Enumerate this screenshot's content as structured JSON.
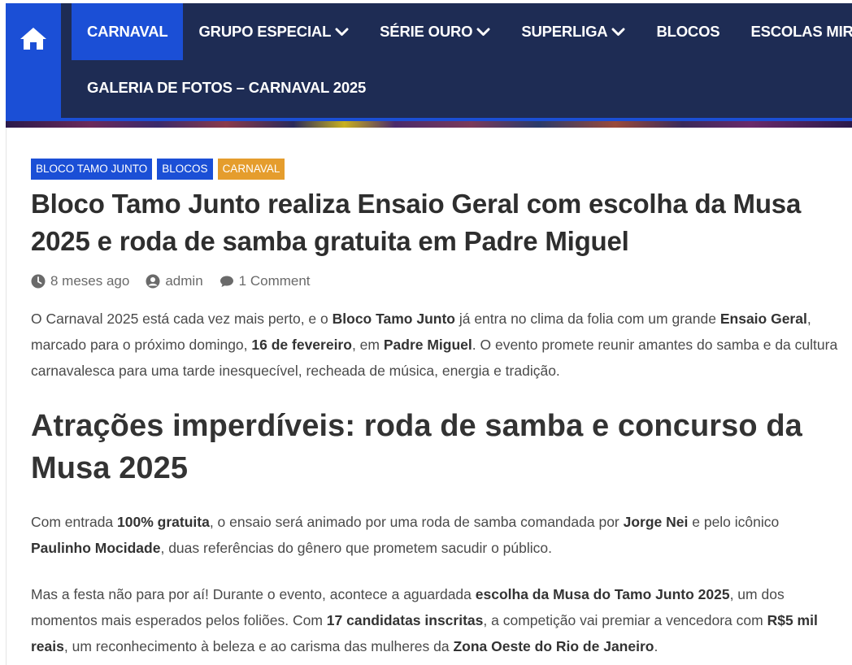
{
  "nav": {
    "home_icon": "home-icon",
    "items": [
      {
        "label": "CARNAVAL",
        "active": true,
        "has_dropdown": false
      },
      {
        "label": "GRUPO ESPECIAL",
        "active": false,
        "has_dropdown": true
      },
      {
        "label": "SÉRIE OURO",
        "active": false,
        "has_dropdown": true
      },
      {
        "label": "SUPERLIGA",
        "active": false,
        "has_dropdown": true
      },
      {
        "label": "BLOCOS",
        "active": false,
        "has_dropdown": false
      },
      {
        "label": "ESCOLAS MIRINS",
        "active": false,
        "has_dropdown": false
      }
    ],
    "row2": [
      {
        "label": "GALERIA DE FOTOS – CARNAVAL 2025"
      }
    ],
    "colors": {
      "bar": "#1e2c54",
      "accent": "#1b4fd6"
    }
  },
  "article": {
    "categories": [
      {
        "label": "BLOCO TAMO JUNTO",
        "color": "#1b4fd6"
      },
      {
        "label": "BLOCOS",
        "color": "#1b4fd6"
      },
      {
        "label": "CARNAVAL",
        "color": "#e59d2d"
      }
    ],
    "title": "Bloco Tamo Junto realiza Ensaio Geral com escolha da Musa 2025 e roda de samba gratuita em Padre Miguel",
    "meta": {
      "date": "8 meses ago",
      "author": "admin",
      "comments": "1 Comment"
    },
    "p1": [
      {
        "t": "O Carnaval 2025 está cada vez mais perto, e o "
      },
      {
        "t": "Bloco Tamo Junto",
        "b": true
      },
      {
        "t": " já entra no clima da folia com um grande "
      },
      {
        "t": "Ensaio Geral",
        "b": true
      },
      {
        "t": ", marcado para o próximo domingo, "
      },
      {
        "t": "16 de fevereiro",
        "b": true
      },
      {
        "t": ", em "
      },
      {
        "t": "Padre Miguel",
        "b": true
      },
      {
        "t": ". O evento promete reunir amantes do samba e da cultura carnavalesca para uma tarde inesquecível, recheada de música, energia e tradição."
      }
    ],
    "h2": "Atrações imperdíveis: roda de samba e concurso da Musa 2025",
    "p2": [
      {
        "t": "Com entrada "
      },
      {
        "t": "100% gratuita",
        "b": true
      },
      {
        "t": ", o ensaio será animado por uma roda de samba comandada por "
      },
      {
        "t": "Jorge Nei",
        "b": true
      },
      {
        "t": " e pelo icônico "
      },
      {
        "t": "Paulinho Mocidade",
        "b": true
      },
      {
        "t": ", duas referências do gênero que prometem sacudir o público."
      }
    ],
    "p3": [
      {
        "t": "Mas a festa não para por aí! Durante o evento, acontece a aguardada "
      },
      {
        "t": "escolha da Musa do Tamo Junto 2025",
        "b": true
      },
      {
        "t": ", um dos momentos mais esperados pelos foliões. Com "
      },
      {
        "t": "17 candidatas inscritas",
        "b": true
      },
      {
        "t": ", a competição vai premiar a vencedora com "
      },
      {
        "t": "R$5 mil reais",
        "b": true
      },
      {
        "t": ", um reconhecimento à beleza e ao carisma das mulheres da "
      },
      {
        "t": "Zona Oeste do Rio de Janeiro",
        "b": true
      },
      {
        "t": "."
      }
    ]
  }
}
